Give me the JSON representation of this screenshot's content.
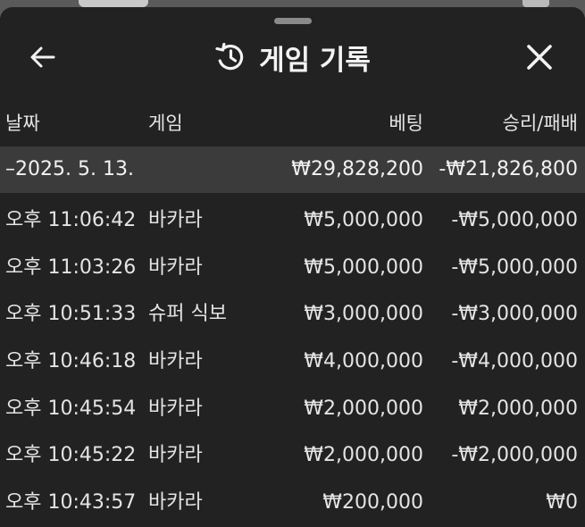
{
  "header": {
    "title": "게임 기록",
    "back_icon": "arrow-left-icon",
    "title_icon": "history-icon",
    "close_icon": "close-icon"
  },
  "columns": {
    "date": "날짜",
    "game": "게임",
    "bet": "베팅",
    "result": "승리/패배"
  },
  "summary": {
    "date": "–2025. 5. 13.",
    "bet": "₩29,828,200",
    "result": "-₩21,826,800"
  },
  "rows": [
    {
      "time": "오후 11:06:42",
      "game": "바카라",
      "bet": "₩5,000,000",
      "result": "-₩5,000,000"
    },
    {
      "time": "오후 11:03:26",
      "game": "바카라",
      "bet": "₩5,000,000",
      "result": "-₩5,000,000"
    },
    {
      "time": "오후 10:51:33",
      "game": "슈퍼 식보",
      "bet": "₩3,000,000",
      "result": "-₩3,000,000"
    },
    {
      "time": "오후 10:46:18",
      "game": "바카라",
      "bet": "₩4,000,000",
      "result": "-₩4,000,000"
    },
    {
      "time": "오후 10:45:54",
      "game": "바카라",
      "bet": "₩2,000,000",
      "result": "₩2,000,000"
    },
    {
      "time": "오후 10:45:22",
      "game": "바카라",
      "bet": "₩2,000,000",
      "result": "-₩2,000,000"
    },
    {
      "time": "오후 10:43:57",
      "game": "바카라",
      "bet": "₩200,000",
      "result": "₩0"
    }
  ],
  "colors": {
    "sheet_background": "#222222",
    "summary_background": "#3b3b3b",
    "text": "#e4e4e4"
  }
}
